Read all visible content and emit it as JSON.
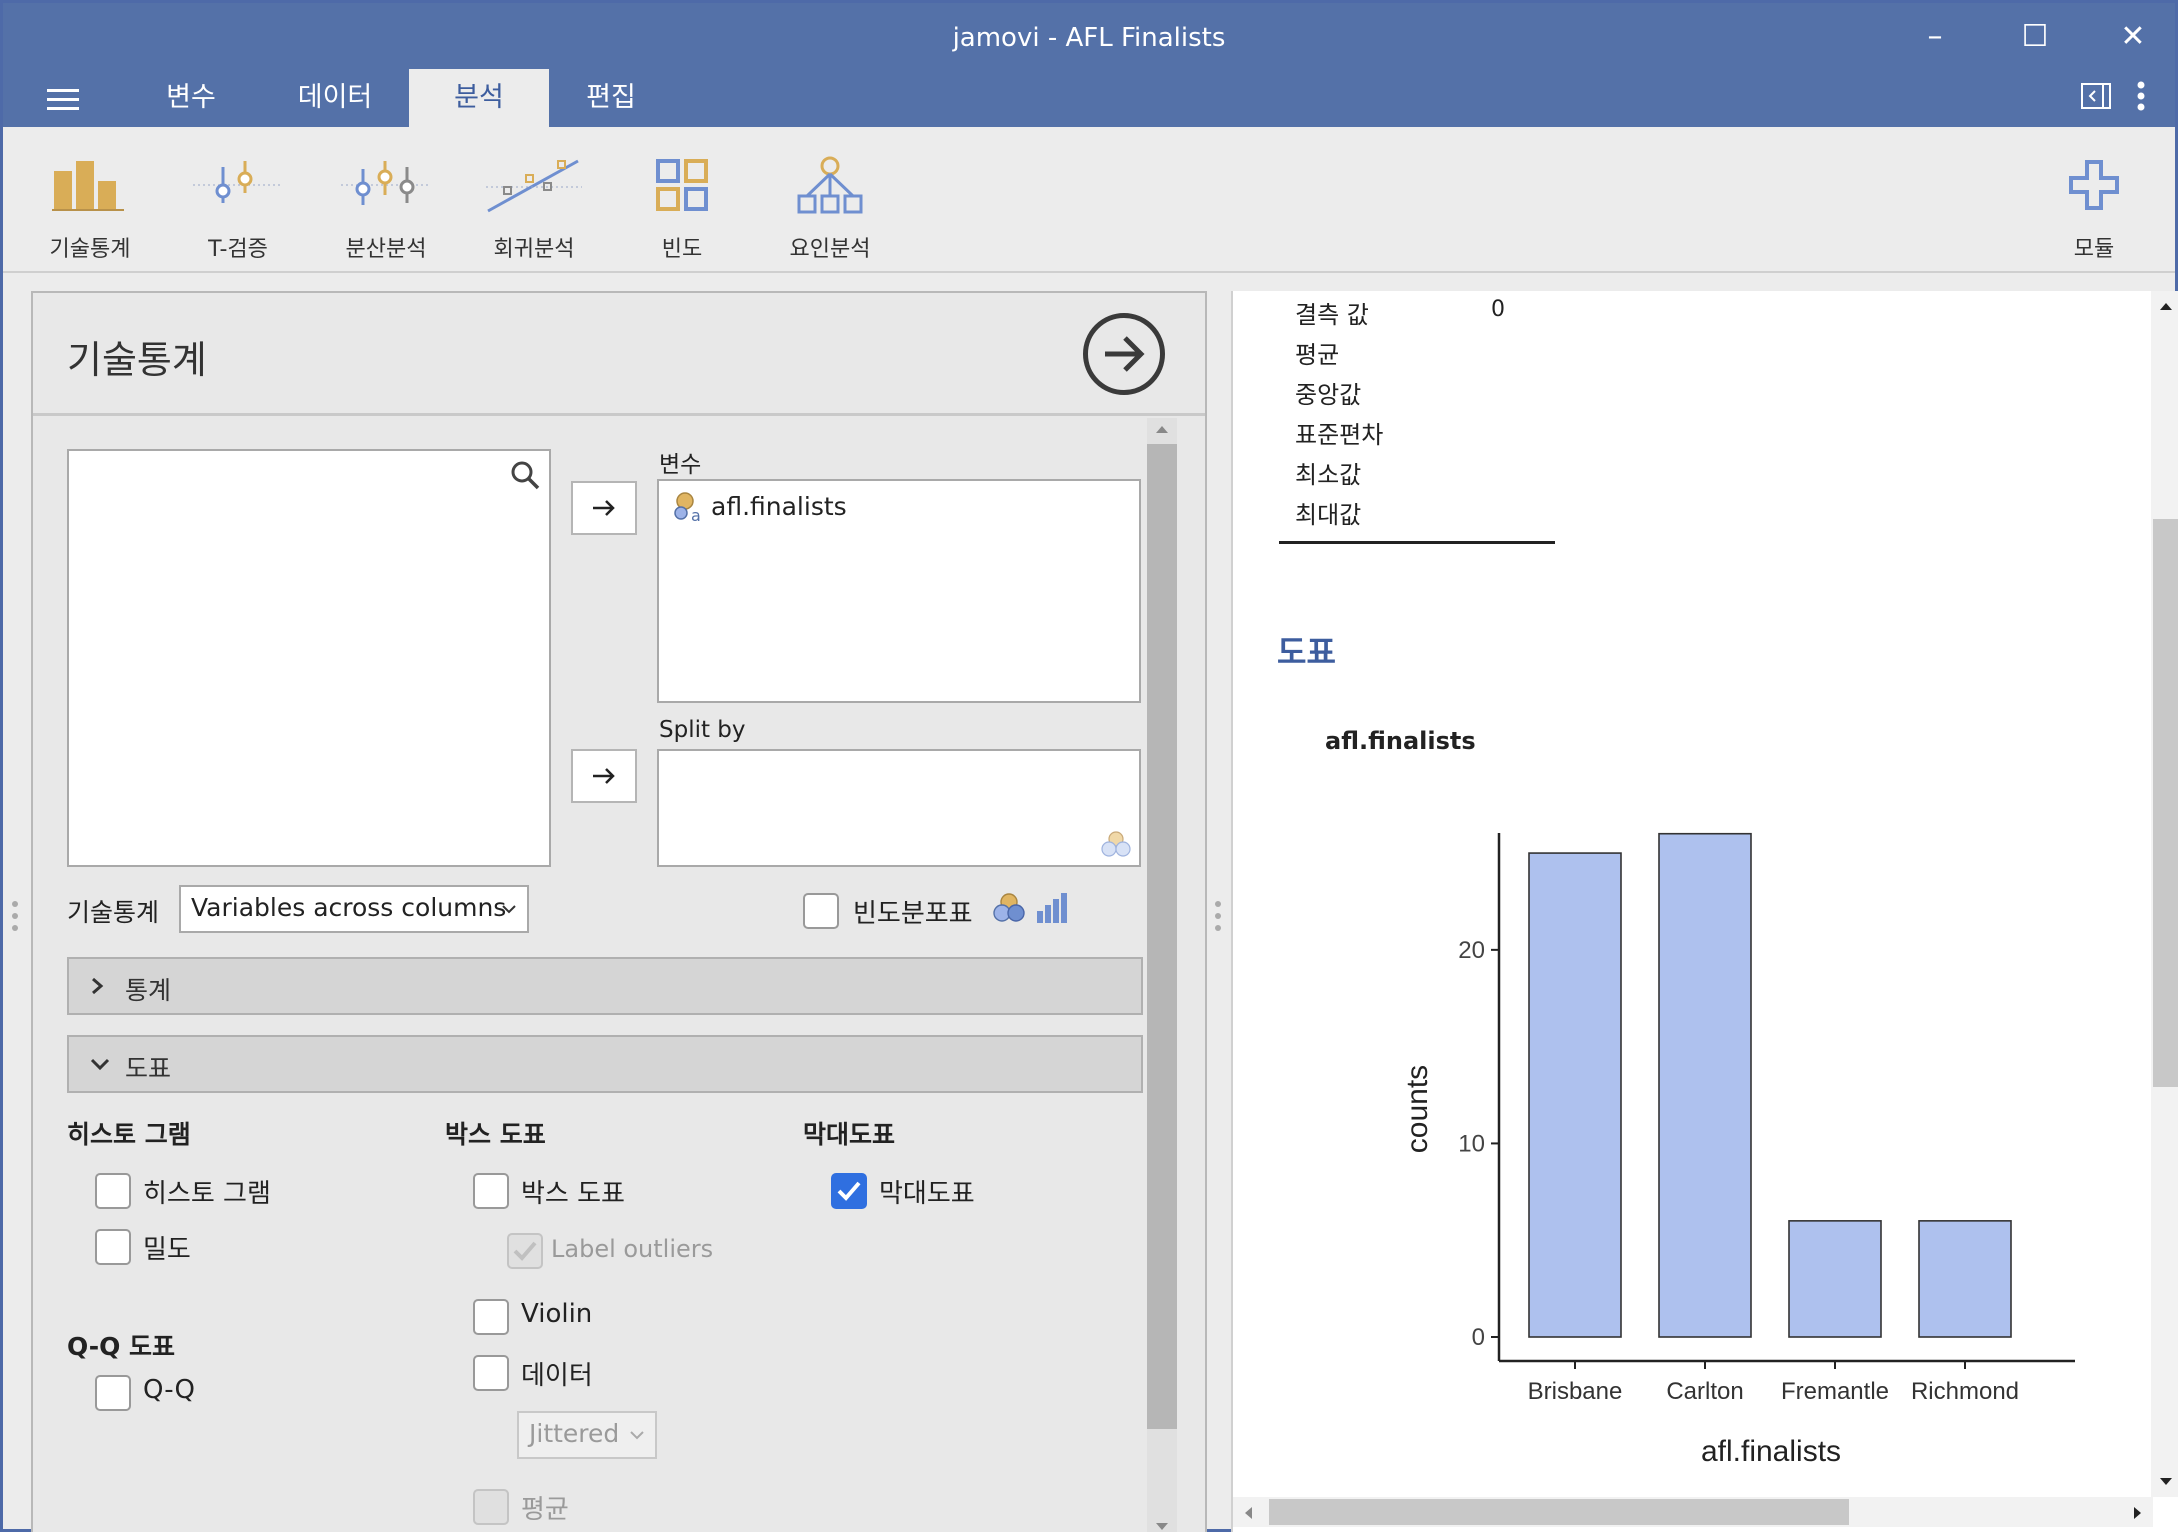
{
  "window": {
    "title": "jamovi - AFL Finalists"
  },
  "tabs": [
    {
      "label": "변수"
    },
    {
      "label": "데이터"
    },
    {
      "label": "분석"
    },
    {
      "label": "편집"
    }
  ],
  "ribbon": {
    "items": [
      {
        "label": "기술통계",
        "icon": "bar-chart-icon"
      },
      {
        "label": "T-검증",
        "icon": "ttest-icon"
      },
      {
        "label": "분산분석",
        "icon": "anova-icon"
      },
      {
        "label": "회귀분석",
        "icon": "regression-icon"
      },
      {
        "label": "빈도",
        "icon": "frequencies-icon"
      },
      {
        "label": "요인분석",
        "icon": "factor-icon"
      }
    ],
    "modules_label": "모듈"
  },
  "analysis": {
    "title": "기술통계",
    "variables_label": "변수",
    "variables": [
      "afl.finalists"
    ],
    "split_by_label": "Split by",
    "descriptives_label": "기술통계",
    "descriptives_select": "Variables across columns",
    "freq_table_label": "빈도분포표",
    "sections": {
      "stats": "통계",
      "plots": "도표"
    },
    "plots": {
      "histogram_head": "히스토 그램",
      "histogram": "히스토 그램",
      "density": "밀도",
      "qq_head": "Q-Q 도표",
      "qq": "Q-Q",
      "box_head": "박스 도표",
      "box": "박스 도표",
      "label_outliers": "Label outliers",
      "violin": "Violin",
      "data": "데이터",
      "jitter_select": "Jittered",
      "mean": "평균",
      "bar_head": "막대도표",
      "bar": "막대도표"
    }
  },
  "results": {
    "rows": [
      {
        "label": "결측 값",
        "value": "0"
      },
      {
        "label": "평균",
        "value": ""
      },
      {
        "label": "중앙값",
        "value": ""
      },
      {
        "label": "표준편차",
        "value": ""
      },
      {
        "label": "최소값",
        "value": ""
      },
      {
        "label": "최대값",
        "value": ""
      }
    ],
    "plots_heading": "도표",
    "plot_title": "afl.finalists"
  },
  "chart_data": {
    "type": "bar",
    "categories": [
      "Brisbane",
      "Carlton",
      "Fremantle",
      "Richmond"
    ],
    "values": [
      25,
      26,
      6,
      6
    ],
    "title": "afl.finalists",
    "xlabel": "afl.finalists",
    "ylabel": "counts",
    "yticks": [
      0,
      10,
      20
    ],
    "ylim": [
      0,
      28
    ],
    "bar_color": "#aec1ee",
    "grid": false
  },
  "colors": {
    "accent": "#5471a8",
    "bar": "#aec1ee",
    "check": "#2f6fe0"
  }
}
